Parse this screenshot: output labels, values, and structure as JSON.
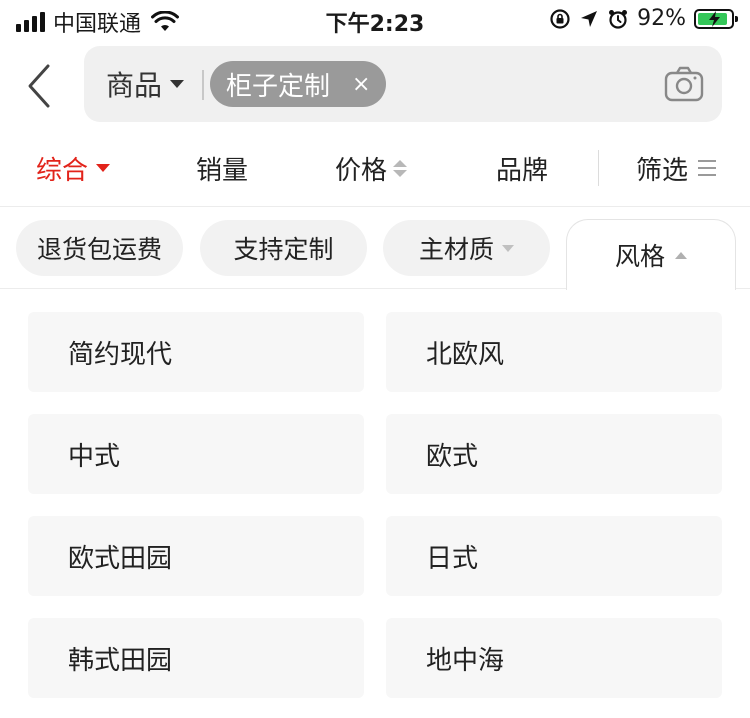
{
  "status_bar": {
    "carrier": "中国联通",
    "time": "下午2:23",
    "battery_percent": "92%",
    "battery_level": 0.92
  },
  "search": {
    "scope_label": "商品",
    "query_chip": "柜子定制",
    "chip_close": "×"
  },
  "sort_bar": {
    "items": [
      "综合",
      "销量",
      "价格",
      "品牌",
      "筛选"
    ],
    "active_index": 0,
    "active_color": "#e2231a"
  },
  "filter_chips": [
    "退货包运费",
    "支持定制",
    "主材质",
    "风格"
  ],
  "style_options": [
    "简约现代",
    "北欧风",
    "中式",
    "欧式",
    "欧式田园",
    "日式",
    "韩式田园",
    "地中海"
  ],
  "icons": {
    "back": "chevron-left-icon",
    "camera": "camera-icon",
    "menu": "menu-lines-icon",
    "wifi": "wifi-icon",
    "location": "location-arrow-icon",
    "alarm": "alarm-icon",
    "lock_rotation": "rotation-lock-icon"
  }
}
